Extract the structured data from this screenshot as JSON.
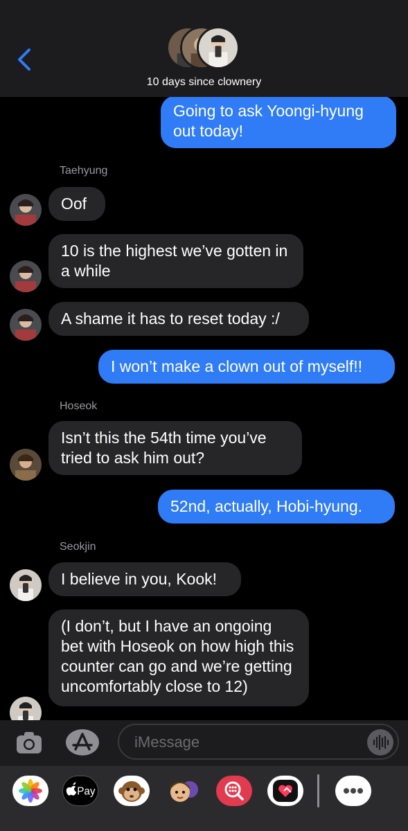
{
  "header": {
    "group_title": "10 days since clownery",
    "back_icon": "chevron-left-icon",
    "accent": "#2f7cf6"
  },
  "messages": [
    {
      "type": "outgoing",
      "text": "Going to ask Yoongi-hyung out today!"
    },
    {
      "type": "sender",
      "text": "Taehyung"
    },
    {
      "type": "incoming",
      "sender": "Taehyung",
      "text": "Oof"
    },
    {
      "type": "incoming",
      "sender": "Taehyung",
      "text": "10 is the highest we’ve gotten in a while"
    },
    {
      "type": "incoming",
      "sender": "Taehyung",
      "text": "A shame it has to reset today :/"
    },
    {
      "type": "outgoing",
      "text": "I won’t make a clown out of myself!!"
    },
    {
      "type": "sender",
      "text": "Hoseok"
    },
    {
      "type": "incoming",
      "sender": "Hoseok",
      "text": "Isn’t this the 54th time you’ve tried to ask him out?"
    },
    {
      "type": "outgoing",
      "text": "52nd, actually, Hobi-hyung."
    },
    {
      "type": "sender",
      "text": "Seokjin"
    },
    {
      "type": "incoming",
      "sender": "Seokjin",
      "text": "I believe in you, Kook!"
    },
    {
      "type": "incoming",
      "sender": "Seokjin",
      "text": "(I don’t, but I have an ongoing bet with Hoseok on how high this counter can go and we’re getting uncomfortably close to 12)"
    }
  ],
  "composer": {
    "placeholder": "iMessage",
    "camera_icon": "camera-icon",
    "apps_icon": "app-store-icon",
    "audio_icon": "audio-waveform-icon"
  },
  "app_drawer": {
    "apps": [
      "photos-icon",
      "apple-pay-icon",
      "memoji-monkey-icon",
      "memoji-icon",
      "search-images-icon",
      "digital-touch-icon",
      "more-icon"
    ],
    "apple_pay_label": "Pay"
  },
  "colors": {
    "outgoing_bubble": "#2f7cf6",
    "incoming_bubble": "#262629",
    "background": "#000000"
  }
}
